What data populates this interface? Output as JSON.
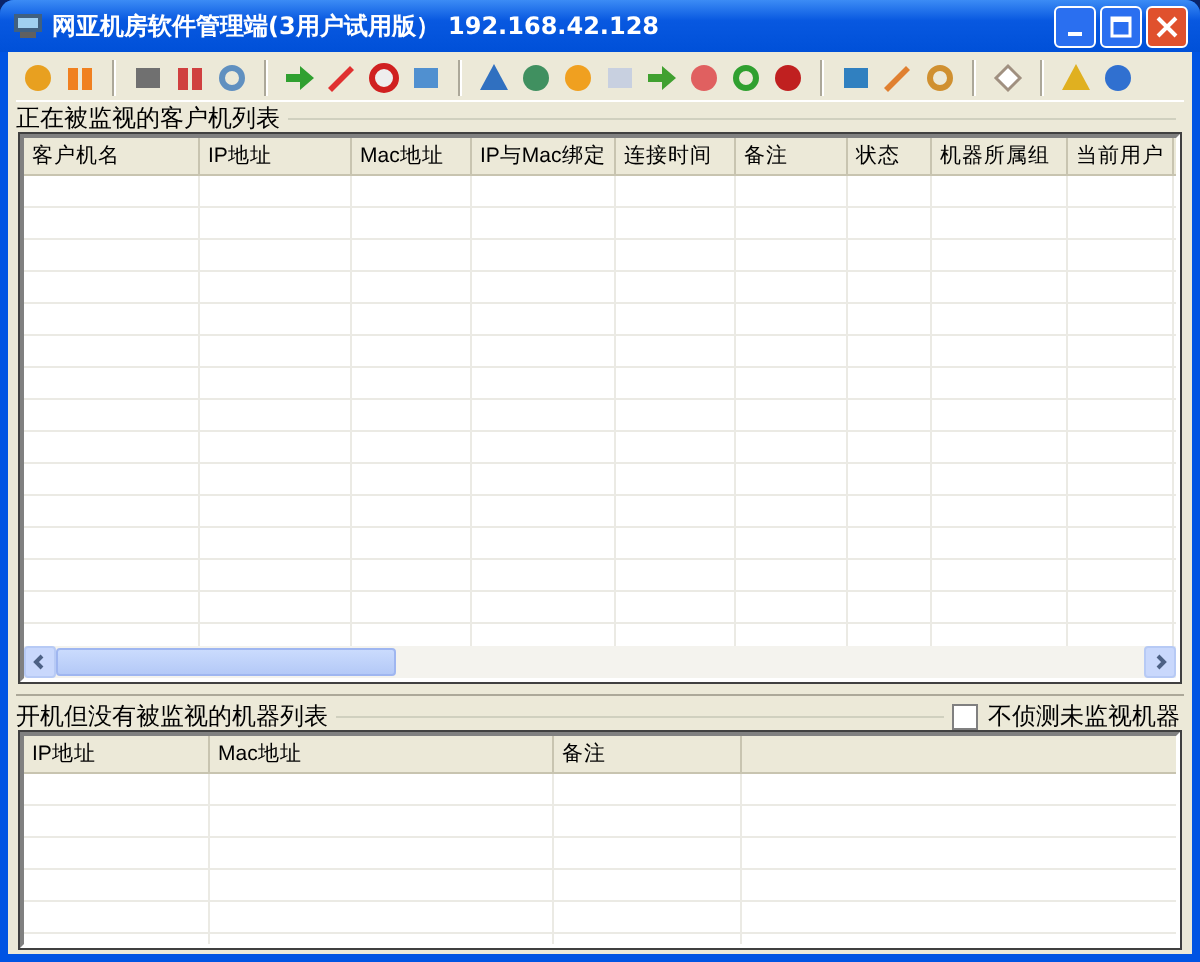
{
  "window": {
    "title": "网亚机房软件管理端(3用户试用版） 192.168.42.128"
  },
  "monitored": {
    "title": "正在被监视的客户机列表",
    "columns": [
      {
        "label": "客户机名"
      },
      {
        "label": "IP地址"
      },
      {
        "label": "Mac地址"
      },
      {
        "label": "IP与Mac绑定"
      },
      {
        "label": "连接时间"
      },
      {
        "label": "备注"
      },
      {
        "label": "状态"
      },
      {
        "label": "机器所属组"
      },
      {
        "label": "当前用户"
      }
    ]
  },
  "unmonitored": {
    "title": "开机但没有被监视的机器列表",
    "option": {
      "label": "不侦测未监视机器",
      "checked": false
    },
    "columns": [
      {
        "label": "IP地址"
      },
      {
        "label": "Mac地址"
      },
      {
        "label": "备注"
      }
    ]
  }
}
